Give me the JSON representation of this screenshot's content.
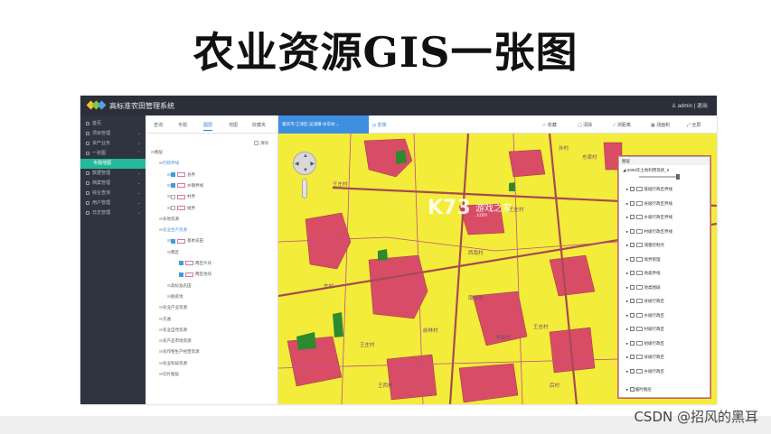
{
  "slide": {
    "title": "农业资源GIS一张图",
    "credit": "CSDN @招风的黑耳"
  },
  "app": {
    "title": "高标准农田管理系统",
    "user": "admin | 退出"
  },
  "sidebar": {
    "items": [
      {
        "label": "首页"
      },
      {
        "label": "项目管理"
      },
      {
        "label": "资产业务"
      },
      {
        "label": "一张图"
      },
      {
        "label": "专题地图",
        "active": true
      },
      {
        "label": "数据管理"
      },
      {
        "label": "档案管理"
      },
      {
        "label": "综合查询"
      },
      {
        "label": "用户管理"
      },
      {
        "label": "日志管理"
      }
    ]
  },
  "tree_panel": {
    "tabs": [
      "查询",
      "专题",
      "图层",
      "地图",
      "收藏夹"
    ],
    "active_tab": "图层",
    "clear_label": "清除",
    "nodes": [
      {
        "label": "图层",
        "level": 0
      },
      {
        "label": "行政界线",
        "level": 1,
        "blue": true
      },
      {
        "label": "县界",
        "level": 2,
        "checked": true,
        "swatch": true
      },
      {
        "label": "乡镇界线",
        "level": 2,
        "checked": true,
        "swatch": true
      },
      {
        "label": "村界",
        "level": 2,
        "swatch": true
      },
      {
        "label": "组界",
        "level": 2,
        "swatch": true
      },
      {
        "label": "农地资源",
        "level": 1
      },
      {
        "label": "农业生产资源",
        "level": 1,
        "blue": true
      },
      {
        "label": "基本农田",
        "level": 2,
        "checked": true,
        "swatch": true
      },
      {
        "label": "两区",
        "level": 2
      },
      {
        "label": "两区片块",
        "level": 3,
        "checked": true,
        "swatch": true
      },
      {
        "label": "两区地块",
        "level": 3,
        "checked": true,
        "swatch": true
      },
      {
        "label": "高标准农田",
        "level": 2
      },
      {
        "label": "脱贫地",
        "level": 2
      },
      {
        "label": "农业产业资源",
        "level": 1
      },
      {
        "label": "交通",
        "level": 1
      },
      {
        "label": "农业自然资源",
        "level": 1
      },
      {
        "label": "农产品市场资源",
        "level": 1
      },
      {
        "label": "农作物生产经营资源",
        "level": 1
      },
      {
        "label": "农业科技资源",
        "level": 1
      },
      {
        "label": "切片图层",
        "level": 1
      }
    ]
  },
  "toolbar": {
    "location": "重庆市-江津区-吴滩镇-水车村",
    "shadow_btn": "影像",
    "tools": [
      "收藏",
      "清除",
      "测距离",
      "测面积",
      "全屏"
    ]
  },
  "legend": {
    "title": "图层",
    "layer": "2009年土地利用现状_0",
    "opacity": 1,
    "items": [
      "基础行政区界线",
      "县级行政区界线",
      "乡级行政区界线",
      "村级行政区界线",
      "测量控制点",
      "境界管理",
      "地类界线",
      "地类图斑",
      "县级行政区",
      "乡级行政区",
      "村级行政区",
      "组级行政区",
      "县级行政区",
      "乡级行政区"
    ],
    "footer": "临时图层"
  },
  "map": {
    "watermark": "K73",
    "watermark_sub": "游戏之家",
    "watermark_url": ".com",
    "labels": [
      "王庄村",
      "孙村",
      "东梁村",
      "西南村",
      "王庄村",
      "南双林",
      "前林村",
      "王庄村",
      "李家村",
      "王吉村",
      "东村",
      "王西村",
      "后村"
    ],
    "colors": {
      "farmland": "#f3ec3a",
      "construction": "#d94c66",
      "forest": "#2e8a2e",
      "road": "#a64a52",
      "boundary": "#c14d8c"
    }
  }
}
